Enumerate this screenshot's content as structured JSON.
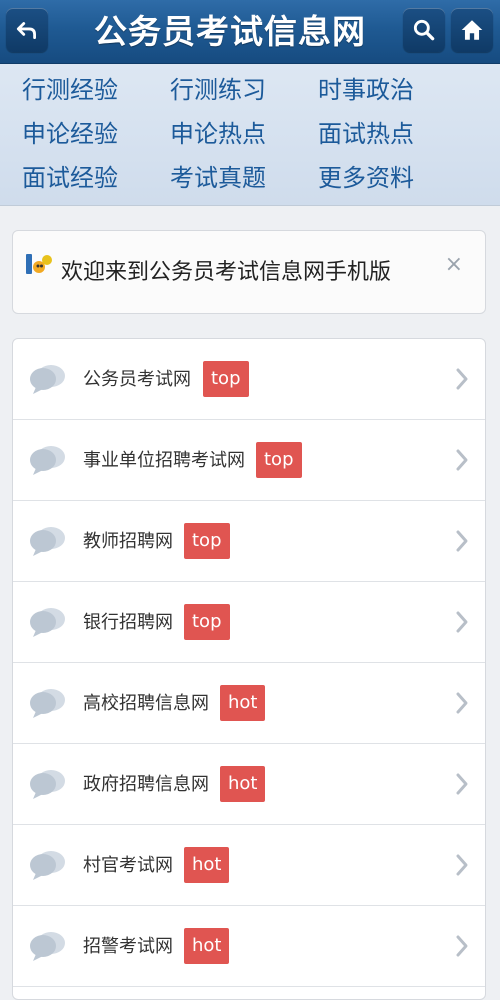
{
  "header": {
    "title": "公务员考试信息网"
  },
  "nav": {
    "items": [
      {
        "label": "行测经验"
      },
      {
        "label": "行测练习"
      },
      {
        "label": "时事政治"
      },
      {
        "label": "申论经验"
      },
      {
        "label": "申论热点"
      },
      {
        "label": "面试热点"
      },
      {
        "label": "面试经验"
      },
      {
        "label": "考试真题"
      },
      {
        "label": "更多资料"
      }
    ]
  },
  "welcome": {
    "text": "欢迎来到公务员考试信息网手机版",
    "close": "×"
  },
  "list": {
    "rows": [
      {
        "label": "公务员考试网",
        "badge": "top"
      },
      {
        "label": "事业单位招聘考试网",
        "badge": "top"
      },
      {
        "label": "教师招聘网",
        "badge": "top"
      },
      {
        "label": "银行招聘网",
        "badge": "top"
      },
      {
        "label": "高校招聘信息网",
        "badge": "hot"
      },
      {
        "label": "政府招聘信息网",
        "badge": "hot"
      },
      {
        "label": "村官考试网",
        "badge": "hot"
      },
      {
        "label": "招警考试网",
        "badge": "hot"
      }
    ]
  },
  "colors": {
    "header": "#1f5a93",
    "nav_text": "#1c5a9a",
    "badge": "#e05551"
  },
  "icons": [
    "back-arrow-icon",
    "search-icon",
    "home-icon",
    "site-logo-icon",
    "chat-bubble-icon",
    "chevron-right-icon"
  ]
}
